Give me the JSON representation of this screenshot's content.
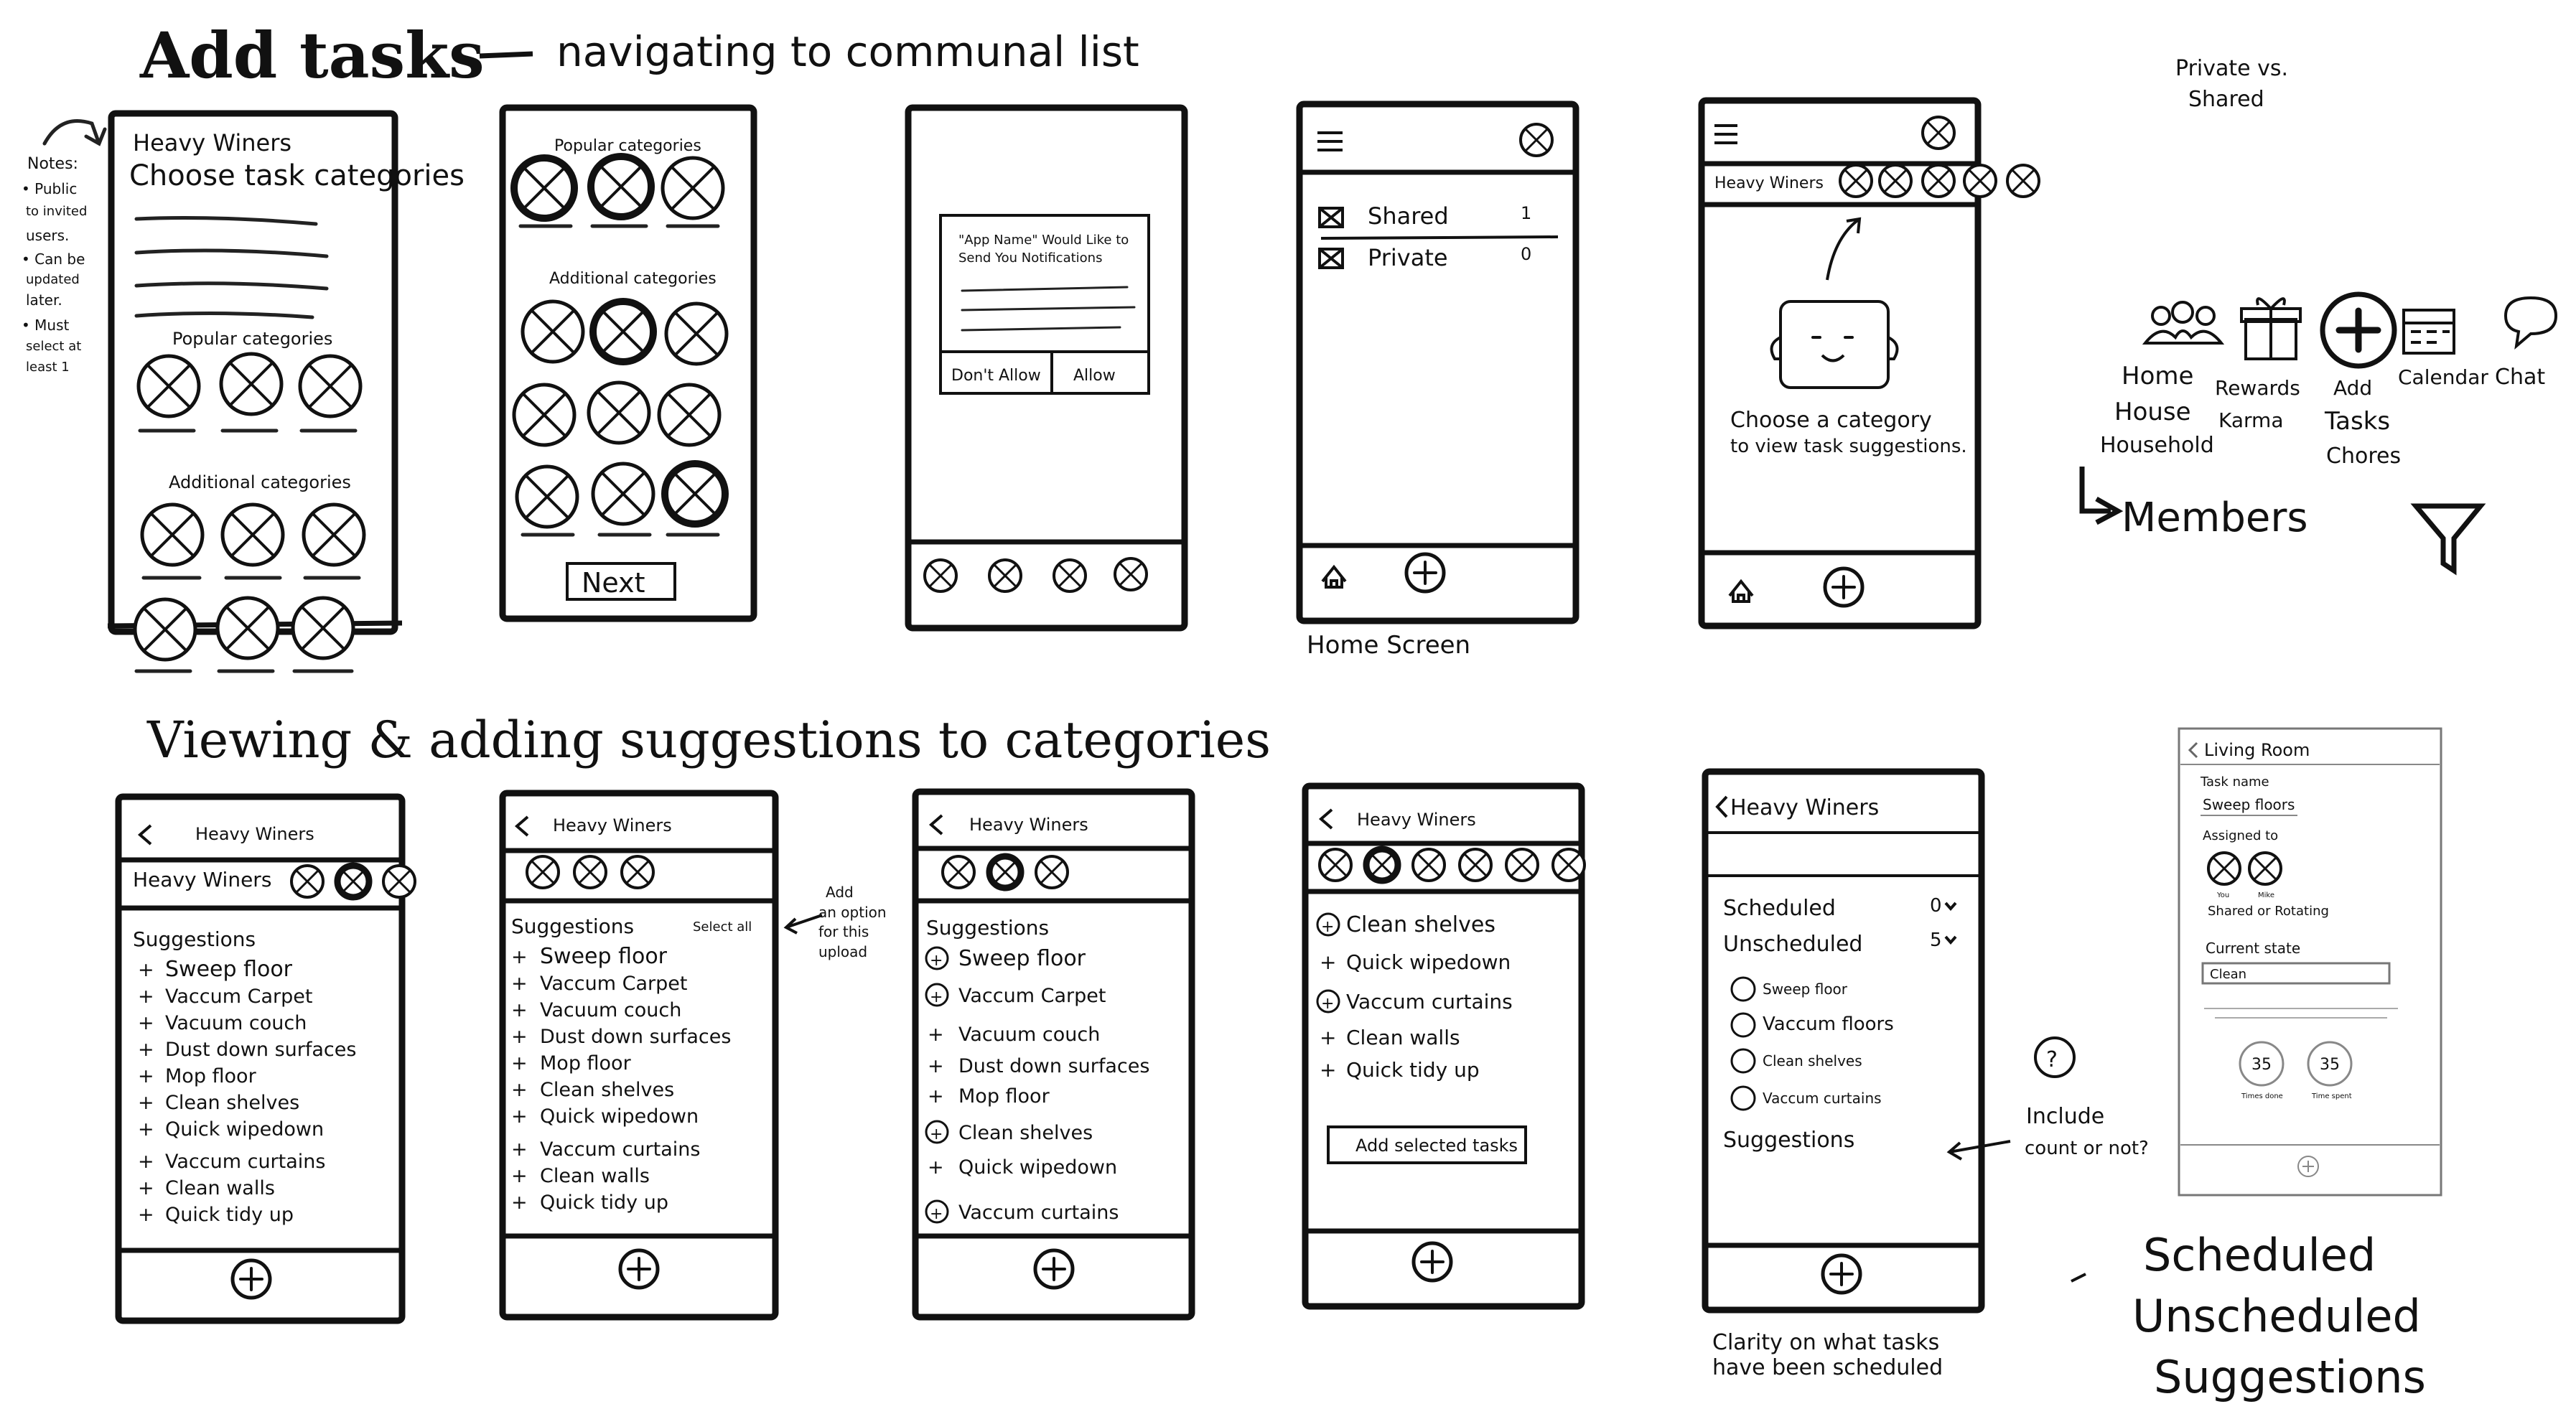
{
  "header": {
    "title_top": "Add tasks",
    "subtitle_top": "navigating to communal list",
    "title_bottom": "Viewing & adding suggestions to categories"
  },
  "notes": {
    "left": [
      "Notes:",
      "• Public",
      "to invited",
      "users.",
      "• Can be",
      "updated",
      "later.",
      "• Must",
      "select at",
      "least 1"
    ],
    "private_vs_shared": [
      "Private vs.",
      "Shared"
    ],
    "add_option": [
      "Add",
      "an option",
      "for this",
      "upload"
    ],
    "include_count": [
      "Include",
      "count or not?"
    ],
    "question": "?",
    "clarity": [
      "Clarity on what tasks",
      "have been scheduled"
    ],
    "home_screen": "Home Screen",
    "members": "Members",
    "scheduled_list": [
      "Scheduled",
      "Unscheduled",
      "Suggestions"
    ]
  },
  "nav_icons": [
    {
      "icon": "people-icon",
      "labels": [
        "Home",
        "House",
        "Household"
      ]
    },
    {
      "icon": "gift-icon",
      "labels": [
        "Rewards",
        "Karma"
      ]
    },
    {
      "icon": "plus-circle-icon",
      "labels": [
        "Add",
        "Tasks",
        "Chores"
      ]
    },
    {
      "icon": "calendar-icon",
      "labels": [
        "Calendar"
      ]
    },
    {
      "icon": "chat-icon",
      "labels": [
        "Chat"
      ]
    }
  ],
  "screens": {
    "s1": {
      "group": "Heavy Winers",
      "heading": "Choose task categories",
      "popular": "Popular categories",
      "additional": "Additional categories"
    },
    "s2": {
      "popular": "Popular categories",
      "additional": "Additional categories",
      "next": "Next"
    },
    "s3": {
      "dialog_title": "\"App Name\" Would Like to",
      "dialog_title2": "Send You Notifications",
      "dont_allow": "Don't Allow",
      "allow": "Allow"
    },
    "s4": {
      "rows": [
        {
          "label": "Shared",
          "count": "1"
        },
        {
          "label": "Private",
          "count": "0"
        }
      ]
    },
    "s5": {
      "group": "Heavy Winers",
      "prompt1": "Choose a category",
      "prompt2": "to view task suggestions."
    },
    "b_group": "Heavy Winers",
    "suggestions": "Suggestions",
    "select_all": "Select all",
    "tasks": [
      "Sweep floor",
      "Vaccum Carpet",
      "Vacuum couch",
      "Dust down surfaces",
      "Mop floor",
      "Clean shelves",
      "Quick wipedown",
      "Vaccum curtains",
      "Clean walls",
      "Quick tidy up"
    ],
    "b4_tasks": [
      "Clean shelves",
      "Quick wipedown",
      "Vaccum curtains",
      "Clean walls",
      "Quick tidy up"
    ],
    "b4_button": "Add selected tasks",
    "b5": {
      "scheduled": "Scheduled",
      "scheduled_count": "0",
      "unscheduled": "Unscheduled",
      "unscheduled_count": "5",
      "items": [
        "Sweep floor",
        "Vaccum floors",
        "Clean shelves",
        "Vaccum curtains"
      ],
      "suggestions": "Suggestions"
    },
    "b6": {
      "back": "Living Room",
      "task_name": "Task name",
      "task_value": "Sweep floors",
      "assigned": "Assigned to",
      "avatar_a": "You",
      "avatar_b": "Mike",
      "shared": "Shared or Rotating",
      "state": "Current state",
      "state_value": "Clean",
      "count_a": "35",
      "count_b": "35",
      "count_a_label": "Times done",
      "count_b_label": "Time spent"
    }
  }
}
